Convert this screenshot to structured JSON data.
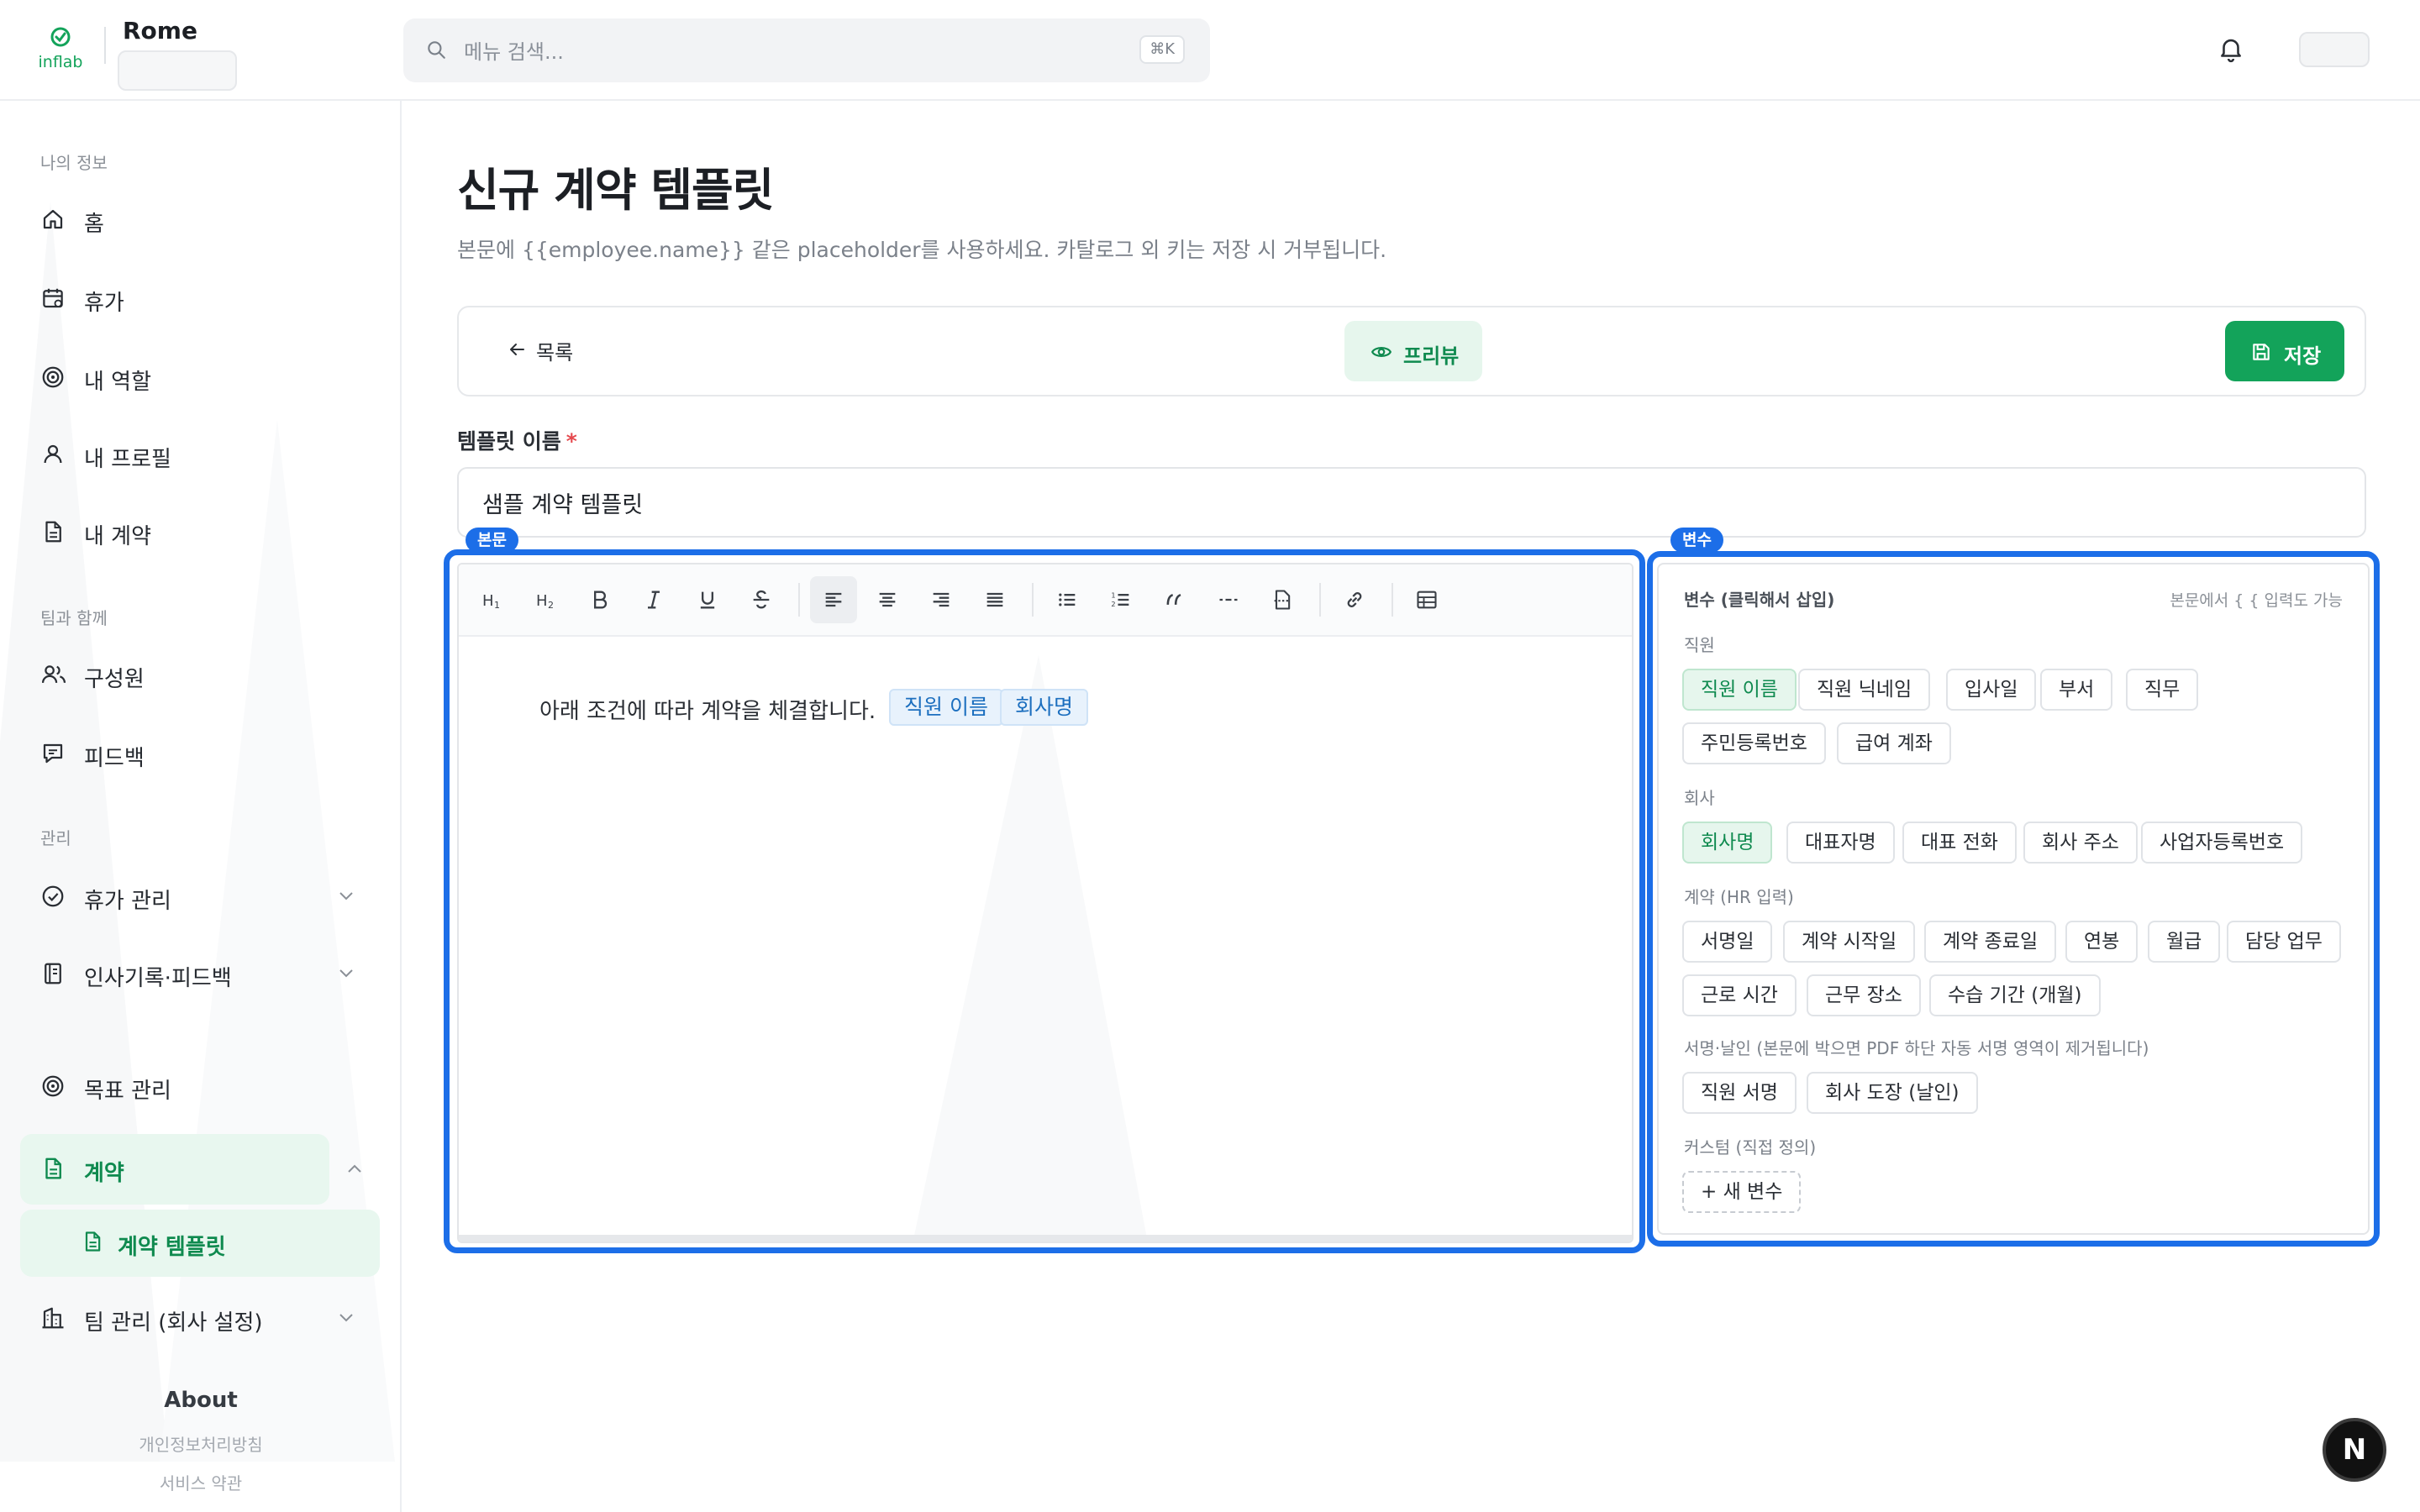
{
  "header": {
    "org_name": "Rome",
    "search_placeholder": "메뉴 검색...",
    "search_shortcut": "⌘K",
    "logo_text": "inflab"
  },
  "sidebar": {
    "section_my": "나의 정보",
    "section_team": "팀과 함께",
    "section_admin": "관리",
    "items": {
      "home": "홈",
      "leave": "휴가",
      "role": "내 역할",
      "profile": "내 프로필",
      "contract_mine": "내 계약",
      "members": "구성원",
      "feedback": "피드백",
      "leave_admin": "휴가 관리",
      "hr_records": "인사기록·피드백",
      "goals": "목표 관리",
      "contracts": "계약",
      "contract_templates": "계약 템플릿",
      "team_admin": "팀 관리 (회사 설정)"
    },
    "about": {
      "title": "About",
      "privacy": "개인정보처리방침",
      "terms": "서비스 약관"
    }
  },
  "main": {
    "title": "신규 계약 템플릿",
    "description": "본문에 {{employee.name}} 같은 placeholder를 사용하세요. 카탈로그 외 키는 저장 시 거부됩니다.",
    "back_label": "목록",
    "preview_label": "프리뷰",
    "save_label": "저장",
    "name_label": "템플릿 이름",
    "required_mark": "*",
    "name_value": "샘플 계약 템플릿"
  },
  "editor": {
    "tag": "본문",
    "body_text": "아래 조건에 따라 계약을 체결합니다.",
    "inline_vars": [
      "직원 이름",
      "회사명"
    ]
  },
  "variables": {
    "tag": "변수",
    "title": "변수 (클릭해서 삽입)",
    "hint": "본문에서 { { 입력도 가능",
    "employee": {
      "label": "직원",
      "chips": [
        "직원 이름",
        "직원 닉네임",
        "입사일",
        "부서",
        "직무",
        "주민등록번호",
        "급여 계좌"
      ]
    },
    "company": {
      "label": "회사",
      "chips": [
        "회사명",
        "대표자명",
        "대표 전화",
        "회사 주소",
        "사업자등록번호"
      ]
    },
    "contract": {
      "label": "계약 (HR 입력)",
      "chips": [
        "서명일",
        "계약 시작일",
        "계약 종료일",
        "연봉",
        "월급",
        "담당 업무",
        "근로 시간",
        "근무 장소",
        "수습 기간 (개월)"
      ]
    },
    "signature": {
      "label": "서명·날인 (본문에 박으면 PDF 하단 자동 서명 영역이 제거됩니다)",
      "chips": [
        "직원 서명",
        "회사 도장 (날인)"
      ]
    },
    "custom": {
      "label": "커스텀 (직접 정의)",
      "add_label": "+ 새 변수"
    }
  },
  "fab": {
    "label": "N"
  },
  "colors": {
    "accent": "#13a35a",
    "accent_soft": "#e6f6ed",
    "highlight": "#1c6ee8",
    "var_chip": "#e8f2fc"
  }
}
